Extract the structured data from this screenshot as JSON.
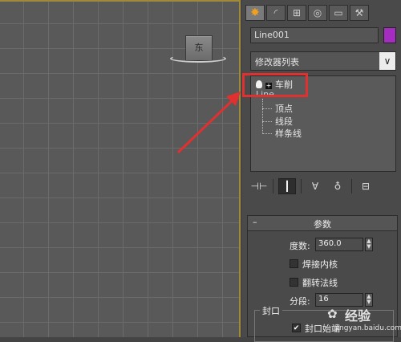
{
  "viewport": {
    "viewcube_label": "东"
  },
  "panel": {
    "tabs": [
      {
        "name": "create",
        "glyph": "✸"
      },
      {
        "name": "modify",
        "glyph": "◜"
      },
      {
        "name": "hierarchy",
        "glyph": "⊞"
      },
      {
        "name": "motion",
        "glyph": "◎"
      },
      {
        "name": "display",
        "glyph": "▭"
      },
      {
        "name": "utilities",
        "glyph": "⚒"
      }
    ],
    "object_name": "Line001",
    "object_color": "#a52cc0",
    "modifier_list": {
      "label": "修改器列表",
      "arrow": "∨"
    },
    "stack": {
      "lathe": "车削",
      "line": "Line",
      "sub_vertex": "顶点",
      "sub_segment": "线段",
      "sub_spline": "样条线"
    },
    "stack_buttons": [
      "⊣⊢",
      "┃",
      "∀",
      "♁",
      "⊟"
    ]
  },
  "params": {
    "title": "参数",
    "collapse": "–",
    "degrees_label": "度数:",
    "degrees_value": "360.0",
    "weld_core_label": "焊接内核",
    "flip_normals_label": "翻转法线",
    "segments_label": "分段:",
    "segments_value": "16",
    "capping_title": "封口",
    "cap_start_label": "封口始端",
    "cap_start_checked": "✔"
  },
  "watermark": {
    "main": "经验",
    "sub": "jingyan.baidu.com",
    "logo": "✿"
  },
  "colors": {
    "highlight": "#e03030",
    "arrow": "#e03030"
  }
}
